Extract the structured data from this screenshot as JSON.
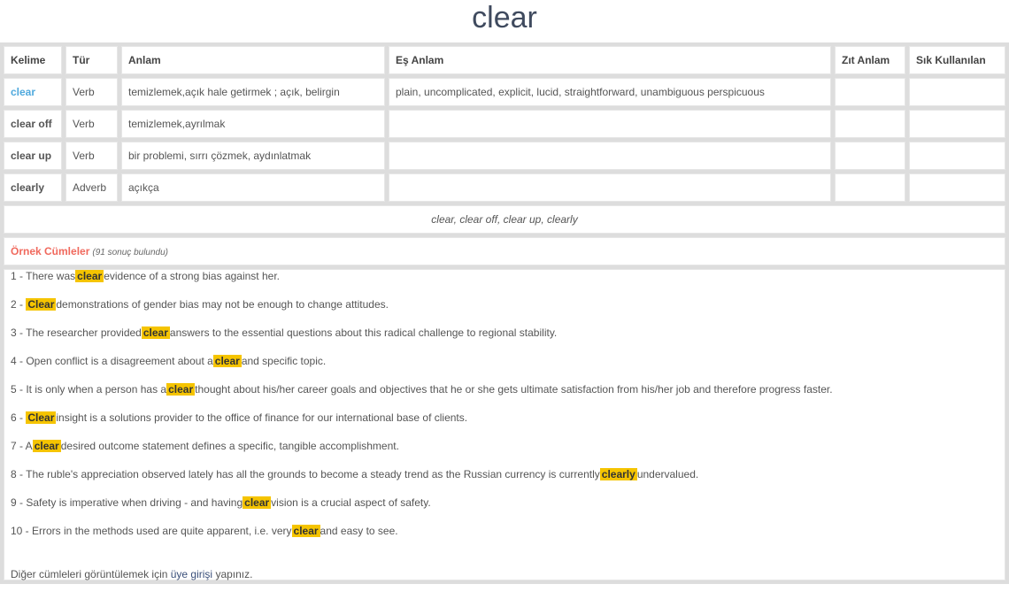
{
  "page_title": "clear",
  "table": {
    "headers": [
      "Kelime",
      "Tür",
      "Anlam",
      "Eş Anlam",
      "Zıt Anlam",
      "Sık Kullanılan"
    ],
    "rows": [
      {
        "word": "clear",
        "type": "Verb",
        "meaning": "temizlemek,açık hale getirmek ; açık, belirgin",
        "synonyms": "plain, uncomplicated, explicit, lucid, straightforward, unambiguous perspicuous",
        "antonyms": "",
        "frequent": "",
        "active": true
      },
      {
        "word": "clear off",
        "type": "Verb",
        "meaning": "temizlemek,ayrılmak",
        "synonyms": "",
        "antonyms": "",
        "frequent": ""
      },
      {
        "word": "clear up",
        "type": "Verb",
        "meaning": "bir problemi, sırrı çözmek, aydınlatmak",
        "synonyms": "",
        "antonyms": "",
        "frequent": ""
      },
      {
        "word": "clearly",
        "type": "Adverb",
        "meaning": "açıkça",
        "synonyms": "",
        "antonyms": "",
        "frequent": ""
      }
    ],
    "related_words": "clear, clear off, clear up, clearly"
  },
  "examples_section": {
    "title": "Örnek Cümleler",
    "count_text": "(91 sonuç bulundu)",
    "highlight_color": "#f5c400",
    "sentences": [
      {
        "num": "1",
        "before": "There was",
        "highlight": "clear",
        "after": "evidence of a strong bias against her."
      },
      {
        "num": "2",
        "before": "",
        "highlight": "Clear",
        "after": "demonstrations of gender bias may not be enough to change attitudes."
      },
      {
        "num": "3",
        "before": "The researcher provided",
        "highlight": "clear",
        "after": "answers to the essential questions about this radical challenge to regional stability."
      },
      {
        "num": "4",
        "before": "Open conflict is a disagreement about a",
        "highlight": "clear",
        "after": "and specific topic."
      },
      {
        "num": "5",
        "before": "It is only when a person has a",
        "highlight": "clear",
        "after": "thought about his/her career goals and objectives that he or she gets ultimate satisfaction from his/her job and therefore progress faster."
      },
      {
        "num": "6",
        "before": "",
        "highlight": "Clear",
        "after": "insight is a solutions provider to the office of finance for our international base of clients."
      },
      {
        "num": "7",
        "before": "A",
        "highlight": "clear",
        "after": "desired outcome statement defines a specific, tangible accomplishment."
      },
      {
        "num": "8",
        "before": "The ruble's appreciation observed lately has all the grounds to become a steady trend as the Russian currency is currently",
        "highlight": "clearly",
        "after": "undervalued."
      },
      {
        "num": "9",
        "before": "Safety is imperative when driving - and having",
        "highlight": "clear",
        "after": "vision is a crucial aspect of safety."
      },
      {
        "num": "10",
        "before": "Errors in the methods used are quite apparent, i.e. very",
        "highlight": "clear",
        "after": "and easy to see."
      }
    ],
    "footer": {
      "before": "Diğer cümleleri görüntülemek için",
      "link": "üye girişi",
      "after": "yapınız."
    }
  }
}
